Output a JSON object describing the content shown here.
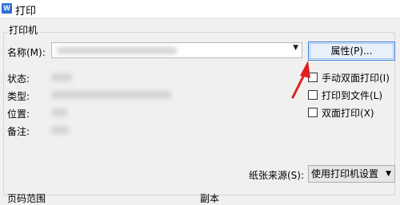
{
  "window": {
    "title": "打印",
    "app_icon": "W"
  },
  "printer_group": {
    "title": "打印机"
  },
  "labels": {
    "name": "名称(M):",
    "status": "状态:",
    "type": "类型:",
    "location": "位置:",
    "comment": "备注:"
  },
  "buttons": {
    "properties": "属性(P)..."
  },
  "options": {
    "manual_duplex": "手动双面打印(I)",
    "print_to_file": "打印到文件(L)",
    "duplex": "双面打印(X)"
  },
  "paper_source": {
    "label": "纸张来源(S):",
    "value": "使用打印机设置"
  },
  "bottom": {
    "page_range": "页码范围",
    "copies": "副本"
  },
  "annotation": {
    "color": "#e02020"
  }
}
